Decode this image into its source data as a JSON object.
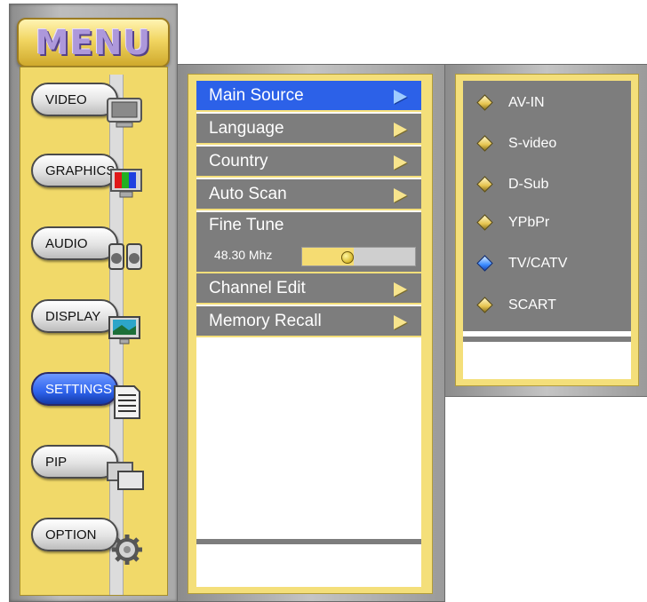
{
  "left_menu": {
    "title": "MENU",
    "items": [
      {
        "label": "VIDEO",
        "active": false,
        "icon": "monitor-icon"
      },
      {
        "label": "GRAPHICS",
        "active": false,
        "icon": "color-bars-icon"
      },
      {
        "label": "AUDIO",
        "active": false,
        "icon": "speaker-icon"
      },
      {
        "label": "DISPLAY",
        "active": false,
        "icon": "display-icon"
      },
      {
        "label": "SETTINGS",
        "active": true,
        "icon": "document-icon"
      },
      {
        "label": "PIP",
        "active": false,
        "icon": "pip-icon"
      },
      {
        "label": "OPTION",
        "active": false,
        "icon": "gear-icon"
      }
    ]
  },
  "settings_menu": {
    "items": [
      {
        "label": "Main Source",
        "selected": true
      },
      {
        "label": "Language",
        "selected": false
      },
      {
        "label": "Country",
        "selected": false
      },
      {
        "label": "Auto Scan",
        "selected": false
      },
      {
        "label": "Channel Edit",
        "selected": false
      },
      {
        "label": "Memory Recall",
        "selected": false
      }
    ],
    "fine_tune": {
      "label": "Fine Tune",
      "value": "48.30 Mhz",
      "level": 0.46
    }
  },
  "source_menu": {
    "items": [
      {
        "label": "AV-IN",
        "selected": false
      },
      {
        "label": "S-video",
        "selected": false
      },
      {
        "label": "D-Sub",
        "selected": false
      },
      {
        "label": "YPbPr",
        "selected": false
      },
      {
        "label": "TV/CATV",
        "selected": true
      },
      {
        "label": "SCART",
        "selected": false
      }
    ]
  },
  "colors": {
    "accent_blue": "#2c61e8",
    "frame_yellow": "#f4df7a",
    "row_gray": "#7d7d7d"
  }
}
